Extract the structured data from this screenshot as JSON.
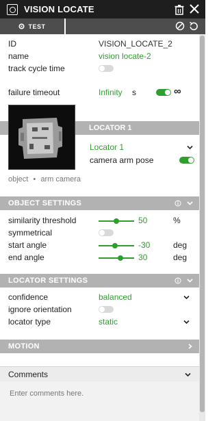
{
  "window": {
    "title": "VISION LOCATE"
  },
  "toolbar": {
    "test_label": "TEST"
  },
  "props": {
    "id_label": "ID",
    "id_value": "VISION_LOCATE_2",
    "name_label": "name",
    "name_value": "vision locate-2",
    "track_label": "track cycle time",
    "failure_label": "failure timeout",
    "failure_value": "Infinity",
    "failure_unit": "s",
    "infinity_symbol": "∞"
  },
  "locator": {
    "header": "LOCATOR 1",
    "select_value": "Locator 1",
    "camera_arm_label": "camera arm pose",
    "caption_object": "object",
    "caption_sep": "•",
    "caption_camera": "arm camera"
  },
  "object_settings": {
    "header": "OBJECT SETTINGS",
    "similarity_label": "similarity threshold",
    "similarity_value": "50",
    "similarity_unit": "%",
    "similarity_level": 0.5,
    "symmetrical_label": "symmetrical",
    "start_label": "start angle",
    "start_value": "-30",
    "start_unit": "deg",
    "end_label": "end angle",
    "end_value": "30",
    "end_unit": "deg"
  },
  "locator_settings": {
    "header": "LOCATOR SETTINGS",
    "confidence_label": "confidence",
    "confidence_value": "balanced",
    "ignore_label": "ignore orientation",
    "type_label": "locator type",
    "type_value": "static"
  },
  "motion": {
    "header": "MOTION"
  },
  "comments": {
    "header": "Comments",
    "placeholder": "Enter comments here."
  },
  "colors": {
    "accent": "#2e9e2e",
    "titlebar": "#1e1e1e",
    "section": "#b2b2b2"
  }
}
